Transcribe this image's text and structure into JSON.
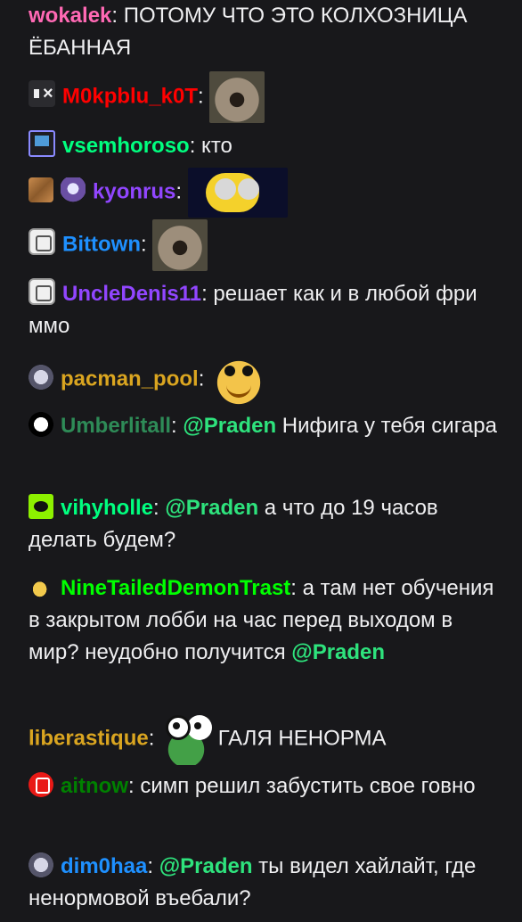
{
  "messages": [
    {
      "user": "wokalek",
      "color": "#ff69b4",
      "text": ": ПОТОМУ ЧТО ЭТО КОЛХОЗНИЦА ЁБАННАЯ"
    },
    {
      "user": "M0kpblu_k0T",
      "color": "#ff0000",
      "text": ": ",
      "emote": "wide-scream-emote"
    },
    {
      "user": "vsemhoroso",
      "color": "#00ff7f",
      "text": ": кто"
    },
    {
      "user": "kyonrus",
      "color": "#9146ff",
      "text": ": ",
      "emote": "minion-emote"
    },
    {
      "user": "Bittown",
      "color": "#1e90ff",
      "text": ": ",
      "emote": "wide-scream-emote"
    },
    {
      "user": "UncleDenis11",
      "color": "#9146ff",
      "text": ": решает как и в любой фри ммо"
    },
    {
      "user": "pacman_pool",
      "color": "#daa520",
      "text": ": ",
      "emote": "smile-emote"
    },
    {
      "user": "Umberlitall",
      "color": "#2e8b57",
      "text": ": ",
      "mention": "@Praden",
      "after": " Нифига у тебя сигара"
    },
    {
      "user": "vihyholle",
      "color": "#00ff7f",
      "text": ": ",
      "mention": "@Praden",
      "after": " а что до 19 часов делать будем?"
    },
    {
      "user": "NineTailedDemonTrast",
      "color": "#00ff00",
      "text": ": а там нет обучения в закрытом лобби на час перед выходом в мир? неудобно получится ",
      "mention_end": "@Praden"
    },
    {
      "user": "liberastique",
      "color": "#daa520",
      "text": ": ",
      "emote": "pepe-emote",
      "after": " ГАЛЯ НЕНОРМА"
    },
    {
      "user": "aitnow",
      "color": "#008000",
      "text": ": симп решил забустить свое говно"
    },
    {
      "user": "dim0haa",
      "color": "#1e90ff",
      "text": ": ",
      "mention": "@Praden",
      "after": " ты видел хайлайт, где ненормовой въебали?"
    }
  ]
}
